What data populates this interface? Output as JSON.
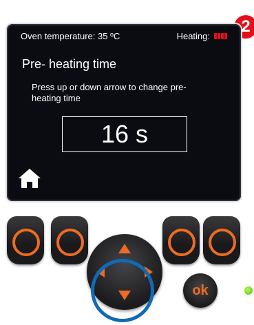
{
  "colors": {
    "accent": "#e3101b",
    "keypad_orange": "#ed6c21",
    "highlight_blue": "#116ab5",
    "led_green": "#6ad01d"
  },
  "step_badge": "2",
  "screen": {
    "oven_temperature": "Oven temperature: 35 ºC",
    "heating_label": "Heating:",
    "heating_level_bars": 4,
    "title": "Pre- heating time",
    "instruction": "Press up or down arrow to change pre- heating time",
    "value": "16 s",
    "home_icon": "home-icon"
  },
  "keypad": {
    "ok_label": "ok",
    "up_icon": "arrow-up-icon",
    "down_icon": "arrow-down-icon",
    "left_icon": "arrow-left-icon",
    "right_icon": "arrow-right-icon",
    "highlighted_key": "down"
  }
}
